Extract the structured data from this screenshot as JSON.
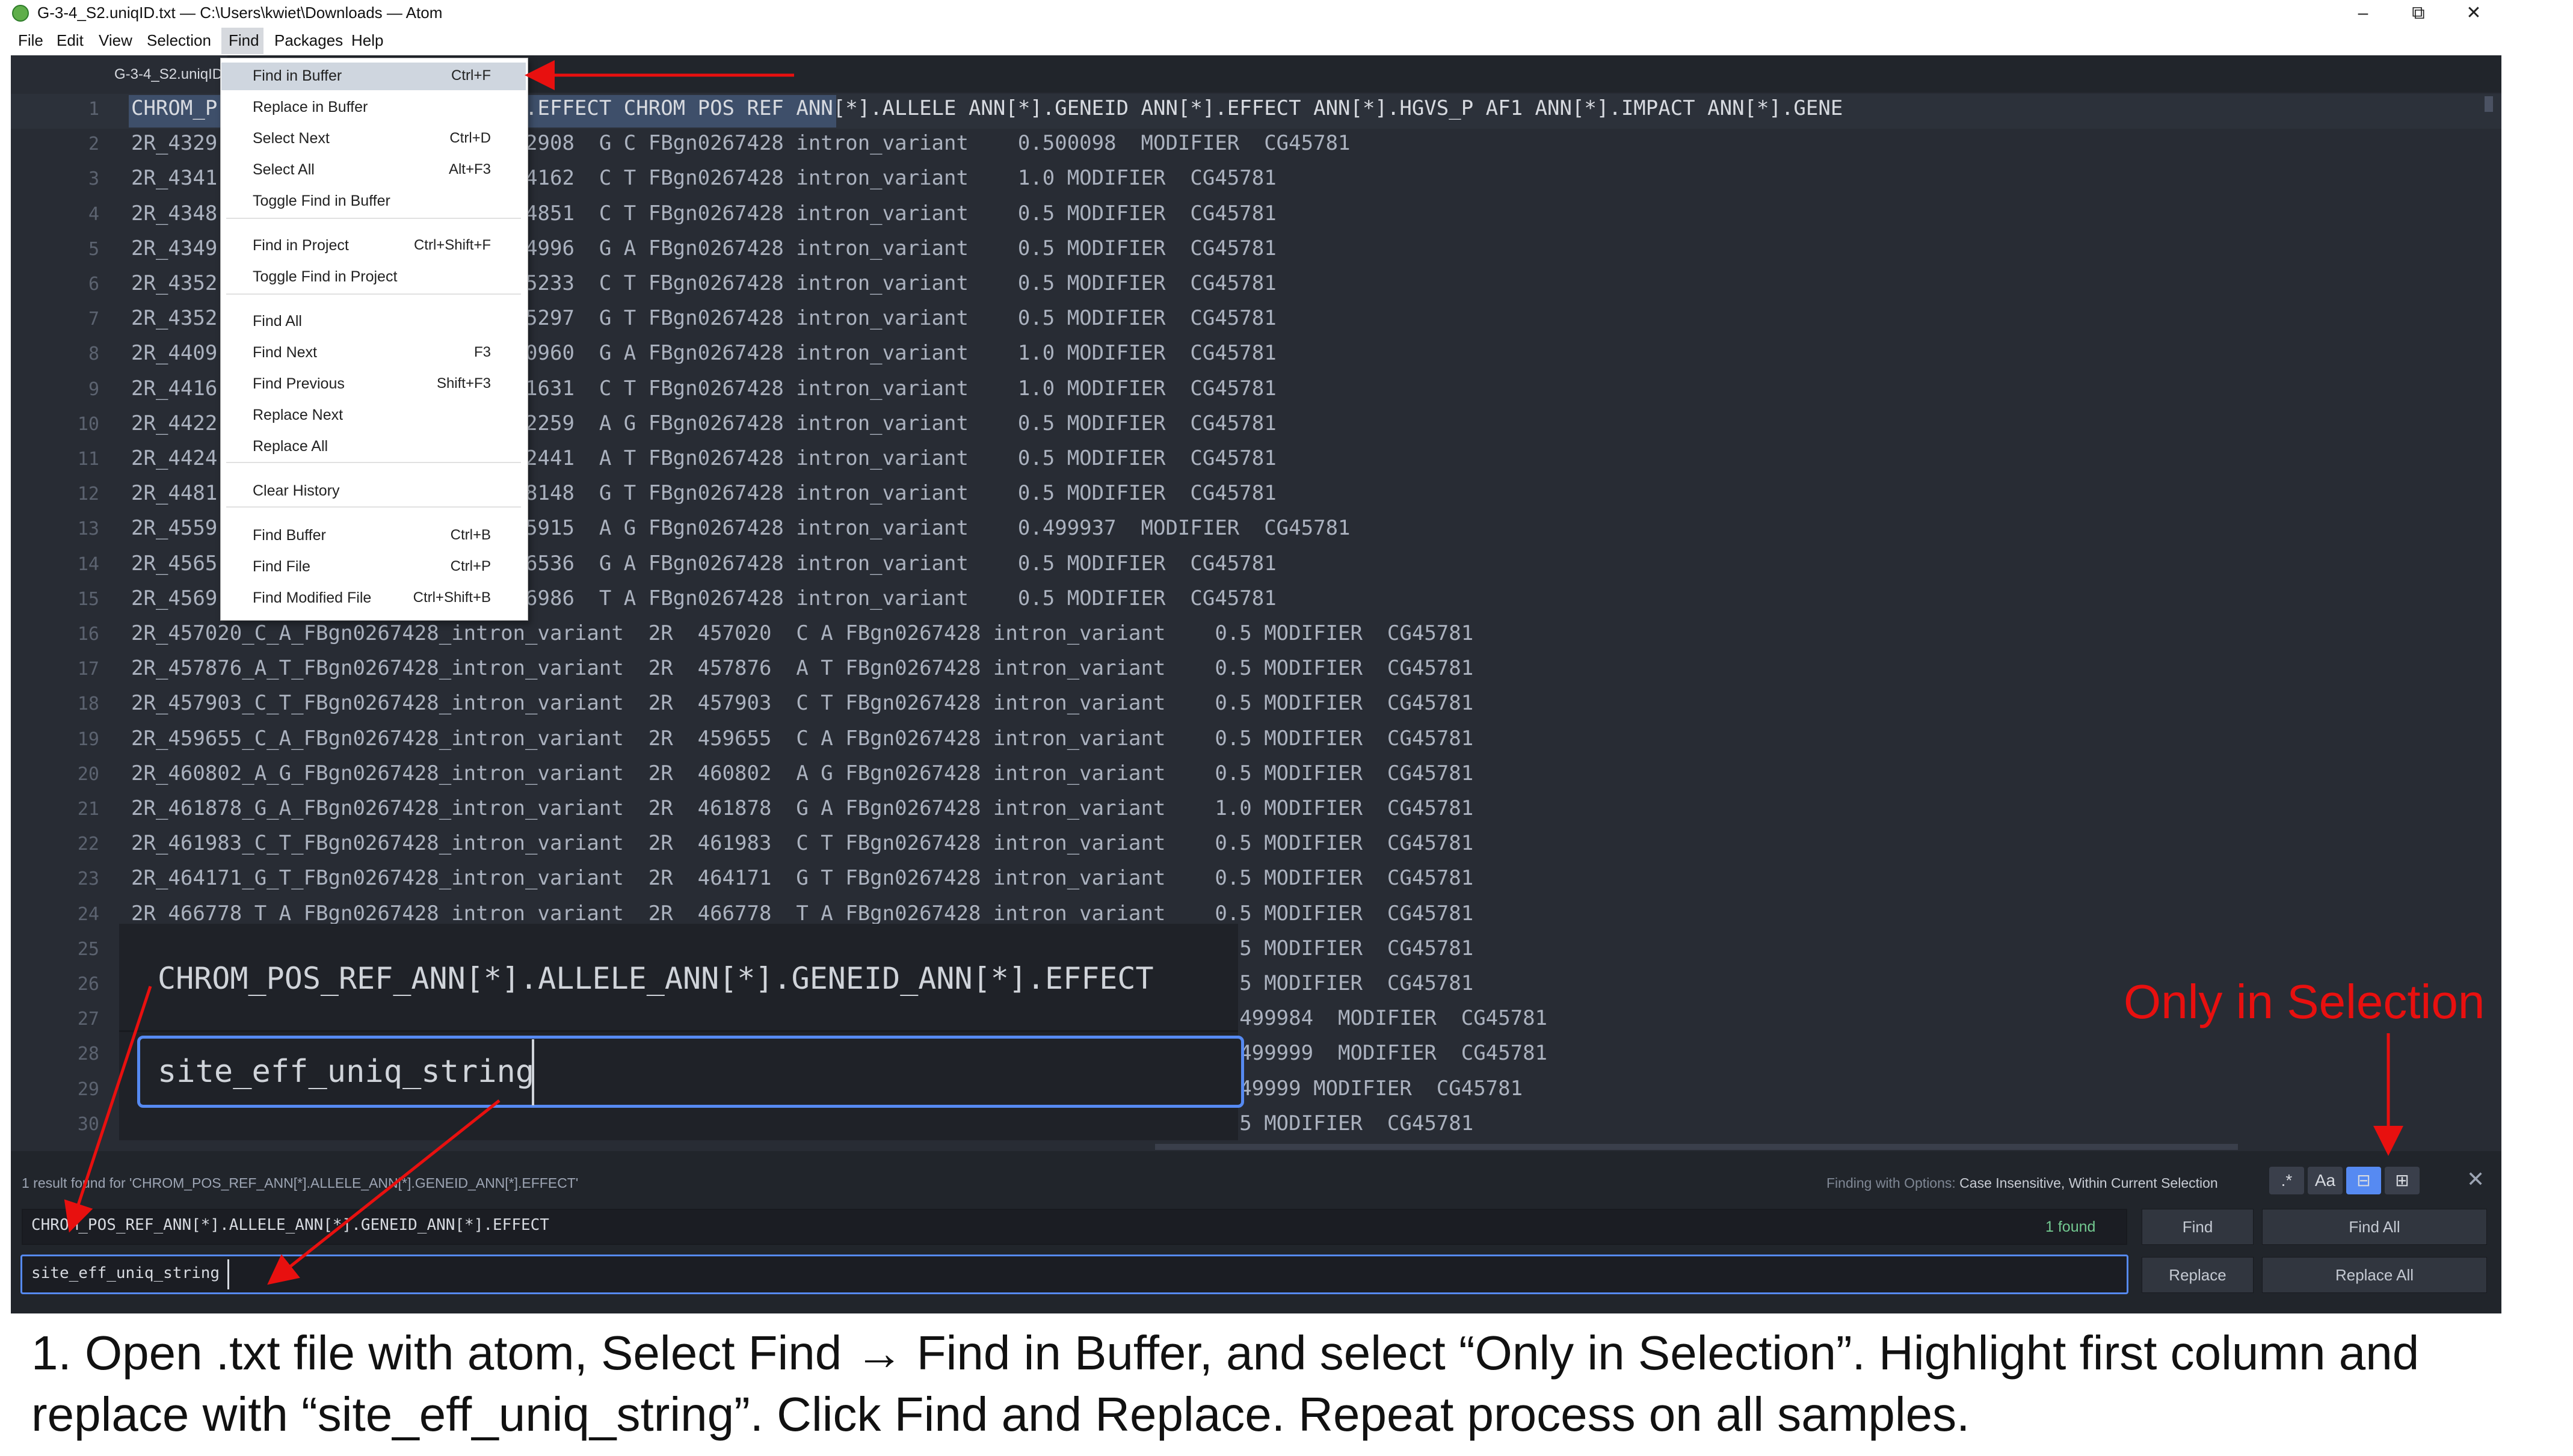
{
  "window": {
    "title": "G-3-4_S2.uniqID.txt — C:\\Users\\kwiet\\Downloads — Atom",
    "controls": [
      "–",
      "⧉",
      "✕"
    ]
  },
  "menubar": [
    "File",
    "Edit",
    "View",
    "Selection",
    "Find",
    "Packages",
    "Help"
  ],
  "tab": {
    "label": "G-3-4_S2.uniqID"
  },
  "find_menu": [
    {
      "label": "Find in Buffer",
      "shortcut": "Ctrl+F"
    },
    {
      "label": "Replace in Buffer",
      "shortcut": ""
    },
    {
      "label": "Select Next",
      "shortcut": "Ctrl+D"
    },
    {
      "label": "Select All",
      "shortcut": "Alt+F3"
    },
    {
      "label": "Toggle Find in Buffer",
      "shortcut": ""
    },
    {
      "label": "Find in Project",
      "shortcut": "Ctrl+Shift+F"
    },
    {
      "label": "Toggle Find in Project",
      "shortcut": ""
    },
    {
      "label": "Find All",
      "shortcut": ""
    },
    {
      "label": "Find Next",
      "shortcut": "F3"
    },
    {
      "label": "Find Previous",
      "shortcut": "Shift+F3"
    },
    {
      "label": "Replace Next",
      "shortcut": ""
    },
    {
      "label": "Replace All",
      "shortcut": ""
    },
    {
      "label": "Clear History",
      "shortcut": ""
    },
    {
      "label": "Find Buffer",
      "shortcut": "Ctrl+B"
    },
    {
      "label": "Find File",
      "shortcut": "Ctrl+P"
    },
    {
      "label": "Find Modified File",
      "shortcut": "Ctrl+Shift+B"
    }
  ],
  "editor": {
    "line_numbers": [
      "1",
      "2",
      "3",
      "4",
      "5",
      "6",
      "7",
      "8",
      "9",
      "10",
      "11",
      "12",
      "13",
      "14",
      "15",
      "16",
      "17",
      "18",
      "19",
      "20",
      "21",
      "22",
      "23",
      "24",
      "25",
      "26",
      "27",
      "28",
      "29",
      "30"
    ],
    "lines": [
      "CHROM_P        [*].GENEID_ANN[*].EFFECT CHROM POS REF ANN[*].ALLELE ANN[*].GENEID ANN[*].EFFECT ANN[*].HGVS_P AF1 ANN[*].IMPACT ANN[*].GENE",
      "2R_4329        n_variant  2R  432908  G C FBgn0267428 intron_variant    0.500098  MODIFIER  CG45781",
      "2R_4341        n_variant  2R  434162  C T FBgn0267428 intron_variant    1.0 MODIFIER  CG45781",
      "2R_4348        n_variant  2R  434851  C T FBgn0267428 intron_variant    0.5 MODIFIER  CG45781",
      "2R_4349        n_variant  2R  434996  G A FBgn0267428 intron_variant    0.5 MODIFIER  CG45781",
      "2R_4352        n_variant  2R  435233  C T FBgn0267428 intron_variant    0.5 MODIFIER  CG45781",
      "2R_4352        n_variant  2R  435297  G T FBgn0267428 intron_variant    0.5 MODIFIER  CG45781",
      "2R_4409        n_variant  2R  440960  G A FBgn0267428 intron_variant    1.0 MODIFIER  CG45781",
      "2R_4416        n_variant  2R  441631  C T FBgn0267428 intron_variant    1.0 MODIFIER  CG45781",
      "2R_4422        n_variant  2R  442259  A G FBgn0267428 intron_variant    0.5 MODIFIER  CG45781",
      "2R_4424        n_variant  2R  442441  A T FBgn0267428 intron_variant    0.5 MODIFIER  CG45781",
      "2R_4481        n_variant  2R  448148  G T FBgn0267428 intron_variant    0.5 MODIFIER  CG45781",
      "2R_4559        n_variant  2R  455915  A G FBgn0267428 intron_variant    0.499937  MODIFIER  CG45781",
      "2R_4565        n_variant  2R  456536  G A FBgn0267428 intron_variant    0.5 MODIFIER  CG45781",
      "2R_4569        n_variant  2R  456986  T A FBgn0267428 intron_variant    0.5 MODIFIER  CG45781",
      "2R_457020_C_A_FBgn0267428_intron_variant  2R  457020  C A FBgn0267428 intron_variant    0.5 MODIFIER  CG45781",
      "2R_457876_A_T_FBgn0267428_intron_variant  2R  457876  A T FBgn0267428 intron_variant    0.5 MODIFIER  CG45781",
      "2R_457903_C_T_FBgn0267428_intron_variant  2R  457903  C T FBgn0267428 intron_variant    0.5 MODIFIER  CG45781",
      "2R_459655_C_A_FBgn0267428_intron_variant  2R  459655  C A FBgn0267428 intron_variant    0.5 MODIFIER  CG45781",
      "2R_460802_A_G_FBgn0267428_intron_variant  2R  460802  A G FBgn0267428 intron_variant    0.5 MODIFIER  CG45781",
      "2R_461878_G_A_FBgn0267428_intron_variant  2R  461878  G A FBgn0267428 intron_variant    1.0 MODIFIER  CG45781",
      "2R_461983_C_T_FBgn0267428_intron_variant  2R  461983  C T FBgn0267428 intron_variant    0.5 MODIFIER  CG45781",
      "2R_464171_G_T_FBgn0267428_intron_variant  2R  464171  G T FBgn0267428 intron_variant    0.5 MODIFIER  CG45781",
      "2R_466778_T_A_FBgn0267428_intron_variant  2R  466778  T A FBgn0267428 intron_variant    0.5 MODIFIER  CG45781",
      "                                                                                        0.5 MODIFIER  CG45781",
      "                                                                                        0.5 MODIFIER  CG45781",
      "                                                                                        0.499984  MODIFIER  CG45781",
      "                                                                                        0.499999  MODIFIER  CG45781",
      "                                                                                        0.49999 MODIFIER  CG45781",
      "                                                                                        0.5 MODIFIER  CG45781"
    ]
  },
  "zoom_inset": {
    "find_text": "CHROM_POS_REF_ANN[*].ALLELE_ANN[*].GENEID_ANN[*].EFFECT",
    "replace_text": "site_eff_uniq_string"
  },
  "find_panel": {
    "status": "1 result found for 'CHROM_POS_REF_ANN[*].ALLELE_ANN[*].GENEID_ANN[*].EFFECT'",
    "options_prefix": "Finding with Options:",
    "options_value": "Case Insensitive, Within Current Selection",
    "option_buttons": [
      ".*",
      "Aa",
      "⊟",
      "⊞"
    ],
    "close": "✕",
    "find_value": "CHROM_POS_REF_ANN[*].ALLELE_ANN[*].GENEID_ANN[*].EFFECT",
    "found_count": "1 found",
    "replace_value": "site_eff_uniq_string",
    "find_button": "Find",
    "find_all_button": "Find All",
    "replace_button": "Replace",
    "replace_all_button": "Replace All"
  },
  "annotation": {
    "label": "Only in Selection",
    "color": "#e8100f"
  },
  "caption": {
    "line1": "1. Open .txt file with atom, Select Find → Find in Buffer, and select “Only in Selection”. Highlight first column and",
    "line2": "replace with “site_eff_uniq_string”. Click Find and Replace. Repeat process on all samples."
  },
  "colors": {
    "editor_bg": "#282c34",
    "panel_bg": "#21252b",
    "accent": "#568af2",
    "annotation_red": "#e8100f"
  }
}
